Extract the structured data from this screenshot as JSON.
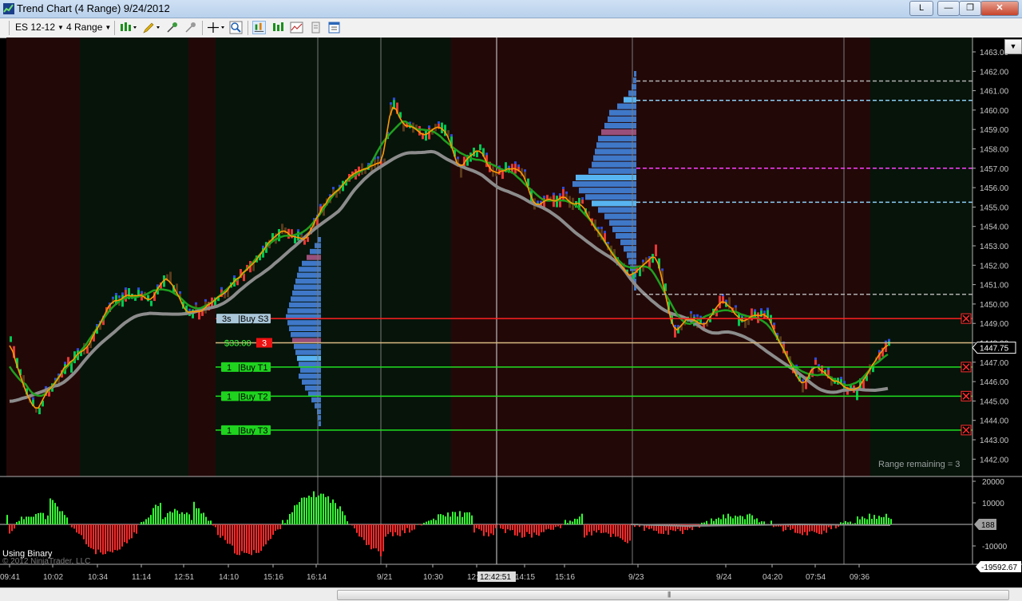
{
  "window": {
    "title": "Trend Chart (4 Range)  9/24/2012",
    "link_label": "L",
    "minimize": "—",
    "maximize": "❐",
    "close": "✕"
  },
  "toolbar": {
    "instrument": "ES 12-12",
    "bar_type": "4 Range"
  },
  "price_axis": {
    "labels": [
      "1463.00",
      "1462.00",
      "1461.00",
      "1460.00",
      "1459.00",
      "1458.00",
      "1457.00",
      "1456.00",
      "1455.00",
      "1454.00",
      "1453.00",
      "1452.00",
      "1451.00",
      "1450.00",
      "1449.00",
      "1448.00",
      "1447.00",
      "1446.00",
      "1445.00",
      "1444.00",
      "1443.00",
      "1442.00"
    ],
    "last_price": "1447.75",
    "last_price_color": "#ffffff"
  },
  "time_axis": {
    "labels": [
      "09:41",
      "10:02",
      "10:34",
      "11:14",
      "12:51",
      "14:10",
      "15:16",
      "16:14",
      "9/21",
      "10:30",
      "12:",
      "14:15",
      "15:16",
      "9/23",
      "9/24",
      "04:20",
      "07:54",
      "09:36"
    ],
    "cursor_time": "12:42:51"
  },
  "orders": [
    {
      "qty": "3s",
      "label": "Buy S3",
      "price": "1449.25",
      "color": "#ff2020",
      "label_bg": "#a9c7d8"
    },
    {
      "qty": "1",
      "label": "Buy T1",
      "price": "1446.75",
      "color": "#20e020",
      "label_bg": "#1fd31f"
    },
    {
      "qty": "1",
      "label": "Buy T2",
      "price": "1445.25",
      "color": "#20e020",
      "label_bg": "#1fd31f"
    },
    {
      "qty": "1",
      "label": "Buy T3",
      "price": "1443.50",
      "color": "#20e020",
      "label_bg": "#1fd31f"
    }
  ],
  "position": {
    "pnl": "$33.00",
    "qty": "3",
    "entry_marker": "1448.00"
  },
  "status": {
    "range_remaining": "Range remaining = 3"
  },
  "indicator": {
    "name": "Using Binary",
    "copyright": "© 2012 NinjaTrader, LLC",
    "axis_labels": [
      "20000",
      "10000",
      "-10000"
    ],
    "current_value": "188",
    "min_value": "-19592.67"
  },
  "colors": {
    "bull_bar": "#00c853",
    "bear_bar": "#e53935",
    "hist_up": "#33ff33",
    "hist_down": "#ff2a2a",
    "ma_fast": "#ff9900",
    "ma_mid": "#1fa01f",
    "ma_slow": "#8c8c8c"
  }
}
